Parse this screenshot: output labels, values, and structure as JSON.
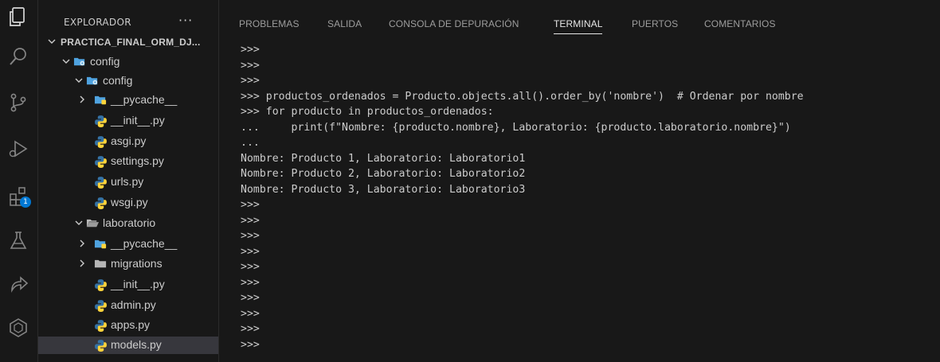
{
  "activity_bar": {
    "icons": [
      "explorer-icon",
      "search-icon",
      "source-control-icon",
      "run-debug-icon",
      "extensions-icon",
      "testing-icon",
      "live-share-icon",
      "remote-explorer-icon"
    ],
    "extensions_badge": "1"
  },
  "sidebar": {
    "title": "EXPLORADOR",
    "more": "···",
    "tree": [
      {
        "label": "PRACTICA_FINAL_ORM_DJ...",
        "indent": 0,
        "chevron": "down",
        "icon": "none",
        "root": true
      },
      {
        "label": "config",
        "indent": 1,
        "chevron": "down",
        "icon": "folder-config"
      },
      {
        "label": "config",
        "indent": 2,
        "chevron": "down",
        "icon": "folder-config"
      },
      {
        "label": "__pycache__",
        "indent": 3,
        "chevron": "right",
        "icon": "folder-pycache"
      },
      {
        "label": "__init__.py",
        "indent": 3,
        "chevron": "none",
        "icon": "python"
      },
      {
        "label": "asgi.py",
        "indent": 3,
        "chevron": "none",
        "icon": "python"
      },
      {
        "label": "settings.py",
        "indent": 3,
        "chevron": "none",
        "icon": "python"
      },
      {
        "label": "urls.py",
        "indent": 3,
        "chevron": "none",
        "icon": "python"
      },
      {
        "label": "wsgi.py",
        "indent": 3,
        "chevron": "none",
        "icon": "python"
      },
      {
        "label": "laboratorio",
        "indent": 2,
        "chevron": "down",
        "icon": "folder-open"
      },
      {
        "label": "__pycache__",
        "indent": 3,
        "chevron": "right",
        "icon": "folder-pycache"
      },
      {
        "label": "migrations",
        "indent": 3,
        "chevron": "right",
        "icon": "folder"
      },
      {
        "label": "__init__.py",
        "indent": 3,
        "chevron": "none",
        "icon": "python"
      },
      {
        "label": "admin.py",
        "indent": 3,
        "chevron": "none",
        "icon": "python"
      },
      {
        "label": "apps.py",
        "indent": 3,
        "chevron": "none",
        "icon": "python"
      },
      {
        "label": "models.py",
        "indent": 3,
        "chevron": "none",
        "icon": "python",
        "selected": true
      }
    ]
  },
  "panel": {
    "tabs": [
      {
        "label": "PROBLEMAS",
        "active": false
      },
      {
        "label": "SALIDA",
        "active": false
      },
      {
        "label": "CONSOLA DE DEPURACIÓN",
        "active": false
      },
      {
        "label": "TERMINAL",
        "active": true
      },
      {
        "label": "PUERTOS",
        "active": false
      },
      {
        "label": "COMENTARIOS",
        "active": false
      }
    ],
    "terminal_lines": [
      ">>>",
      ">>>",
      ">>>",
      ">>> productos_ordenados = Producto.objects.all().order_by('nombre')  # Ordenar por nombre",
      ">>> for producto in productos_ordenados:",
      "...     print(f\"Nombre: {producto.nombre}, Laboratorio: {producto.laboratorio.nombre}\")",
      "...",
      "Nombre: Producto 1, Laboratorio: Laboratorio1",
      "Nombre: Producto 2, Laboratorio: Laboratorio2",
      "Nombre: Producto 3, Laboratorio: Laboratorio3",
      ">>>",
      ">>>",
      ">>>",
      ">>>",
      ">>>",
      ">>>",
      ">>>",
      ">>>",
      ">>>",
      ">>>"
    ]
  },
  "colors": {
    "background": "#181818",
    "selected_row": "#37373d",
    "badge": "#0078d4",
    "text": "#cccccc",
    "folder_blue": "#4fa3e0",
    "python_blue": "#3572a5",
    "python_yellow": "#ffd43b"
  }
}
